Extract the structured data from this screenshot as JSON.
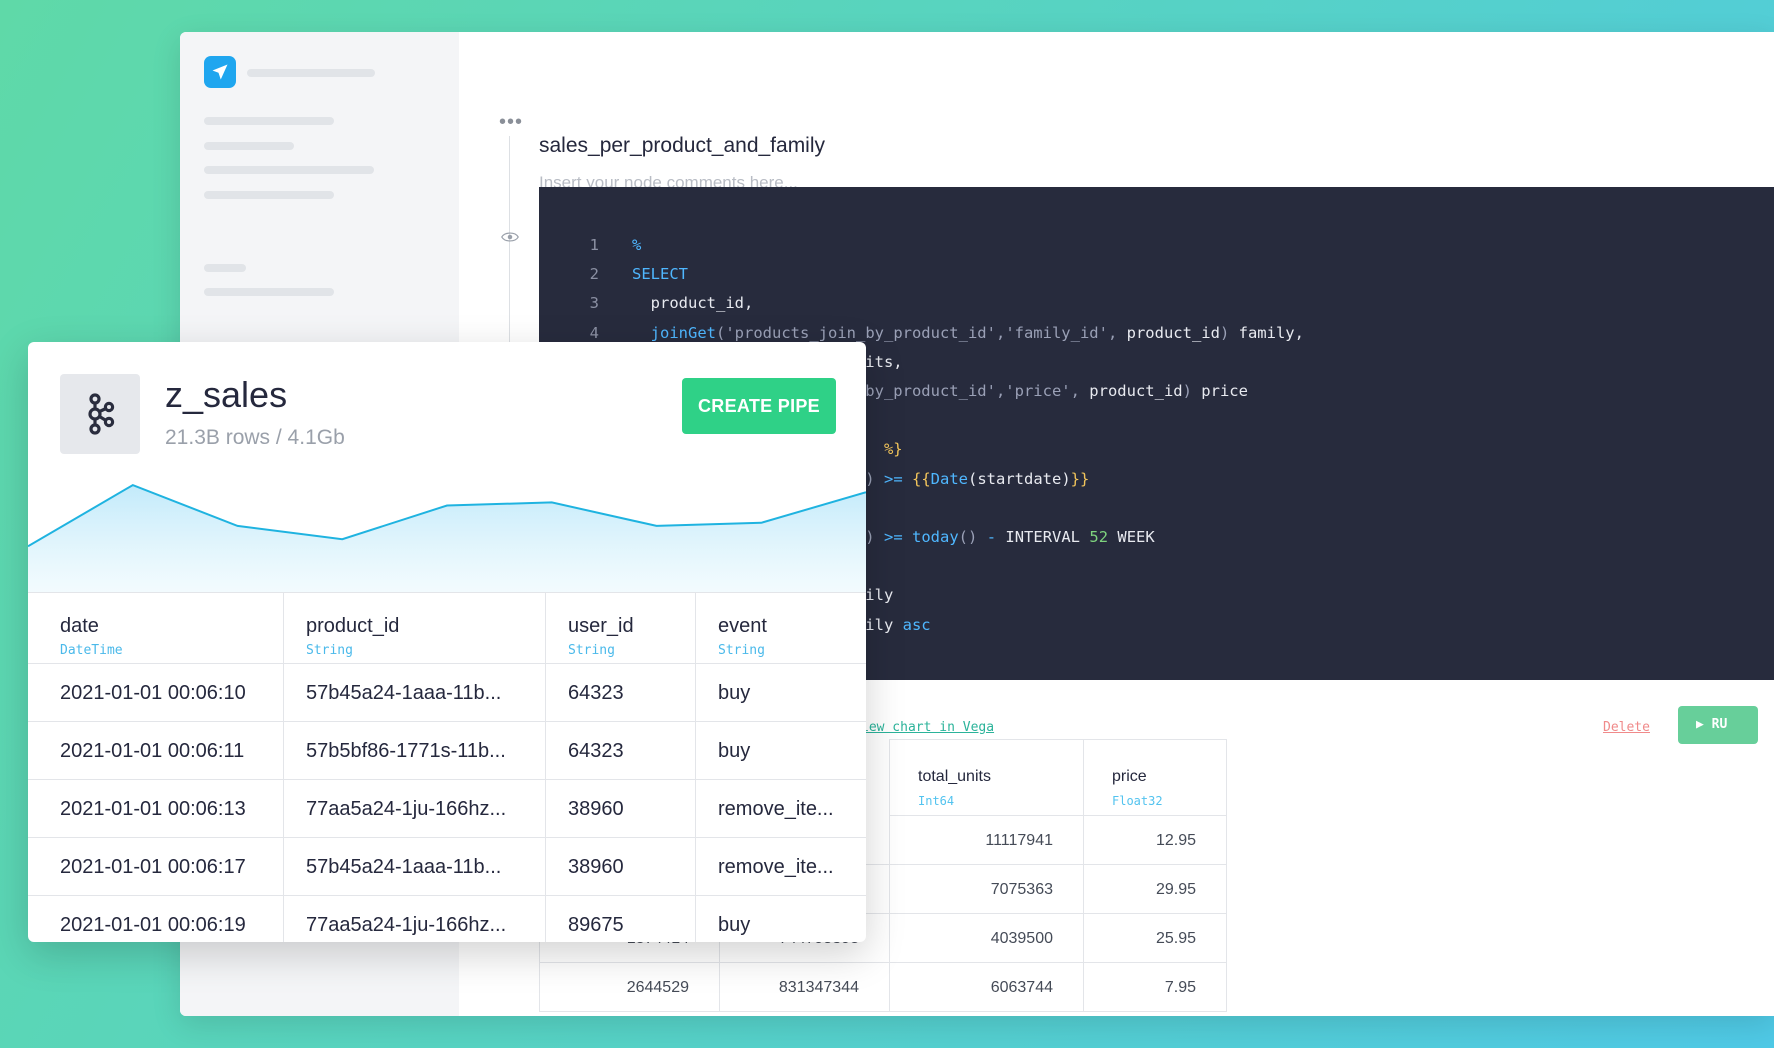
{
  "editor_window": {
    "node": {
      "title": "sales_per_product_and_family",
      "comment_placeholder": "Insert your node comments here..."
    },
    "code_lines": [
      {
        "n": "1",
        "html": "<span class='kw'>%</span>"
      },
      {
        "n": "2",
        "html": "<span class='kw'>SELECT</span>"
      },
      {
        "n": "3",
        "html": "  product_id,"
      },
      {
        "n": "4",
        "html": "  <span class='kw'>joinGet</span><span class='str'>(</span><span class='str'>'products_join_by_product_id'</span><span class='str'>,</span><span class='str'>'family_id'</span><span class='str'>,</span> product_id<span class='str'>)</span> family,"
      },
      {
        "n": "",
        "html": "                         its,"
      },
      {
        "n": "",
        "html": "                         <span class='str'>by_product_id'</span><span class='str'>,</span><span class='str'>'price'</span><span class='str'>,</span> product_id<span class='str'>)</span> price"
      },
      {
        "n": "",
        "html": ""
      },
      {
        "n": "",
        "html": "                           <span class='tpl'>%}</span>"
      },
      {
        "n": "",
        "html": "                         <span class='str'>)</span> <span class='op'>&gt;=</span> <span class='tpl'>{{</span><span class='kw'>Date</span>(startdate)<span class='tpl'>}}</span>"
      },
      {
        "n": "",
        "html": ""
      },
      {
        "n": "",
        "html": "                         <span class='str'>)</span> <span class='op'>&gt;=</span> <span class='kw'>today</span><span class='str'>()</span> <span class='op'>-</span> INTERVAL <span class='num'>52</span> WEEK"
      },
      {
        "n": "",
        "html": ""
      },
      {
        "n": "",
        "html": "                         ily"
      },
      {
        "n": "",
        "html": "                         ily <span class='kw'>asc</span>"
      }
    ],
    "result_bar": {
      "vega_link": "iew chart in Vega",
      "delete_link": "Delete",
      "run_button": "▶ RU"
    },
    "result_table": {
      "columns": [
        {
          "name": "",
          "type": ""
        },
        {
          "name": "",
          "type": ""
        },
        {
          "name": "total_units",
          "type": "Int64"
        },
        {
          "name": "price",
          "type": "Float32"
        }
      ],
      "rows": [
        [
          "",
          "",
          "11117941",
          "12.95"
        ],
        [
          "",
          "",
          "7075363",
          "29.95"
        ],
        [
          "1874414",
          "744795398",
          "4039500",
          "25.95"
        ],
        [
          "2644529",
          "831347344",
          "6063744",
          "7.95"
        ]
      ]
    }
  },
  "datasource_card": {
    "name": "z_sales",
    "stats": "21.3B rows / 4.1Gb",
    "create_button": "CREATE PIPE",
    "icon": "kafka-icon",
    "columns": [
      {
        "name": "date",
        "type": "DateTime"
      },
      {
        "name": "product_id",
        "type": "String"
      },
      {
        "name": "user_id",
        "type": "String"
      },
      {
        "name": "event",
        "type": "String"
      }
    ],
    "rows": [
      [
        "2021-01-01 00:06:10",
        "57b45a24-1aaa-11b...",
        "64323",
        "buy"
      ],
      [
        "2021-01-01 00:06:11",
        "57b5bf86-1771s-11b...",
        "64323",
        "buy"
      ],
      [
        "2021-01-01 00:06:13",
        "77aa5a24-1ju-166hz...",
        "38960",
        "remove_ite..."
      ],
      [
        "2021-01-01 00:06:17",
        "57b45a24-1aaa-11b...",
        "38960",
        "remove_ite..."
      ],
      [
        "2021-01-01 00:06:19",
        "77aa5a24-1ju-166hz...",
        "89675",
        "buy"
      ]
    ],
    "sparkline": [
      0.35,
      0.95,
      0.55,
      0.42,
      0.75,
      0.78,
      0.55,
      0.58,
      0.88
    ],
    "colors": {
      "accent": "#2fd187",
      "line": "#1fb3e0"
    }
  }
}
